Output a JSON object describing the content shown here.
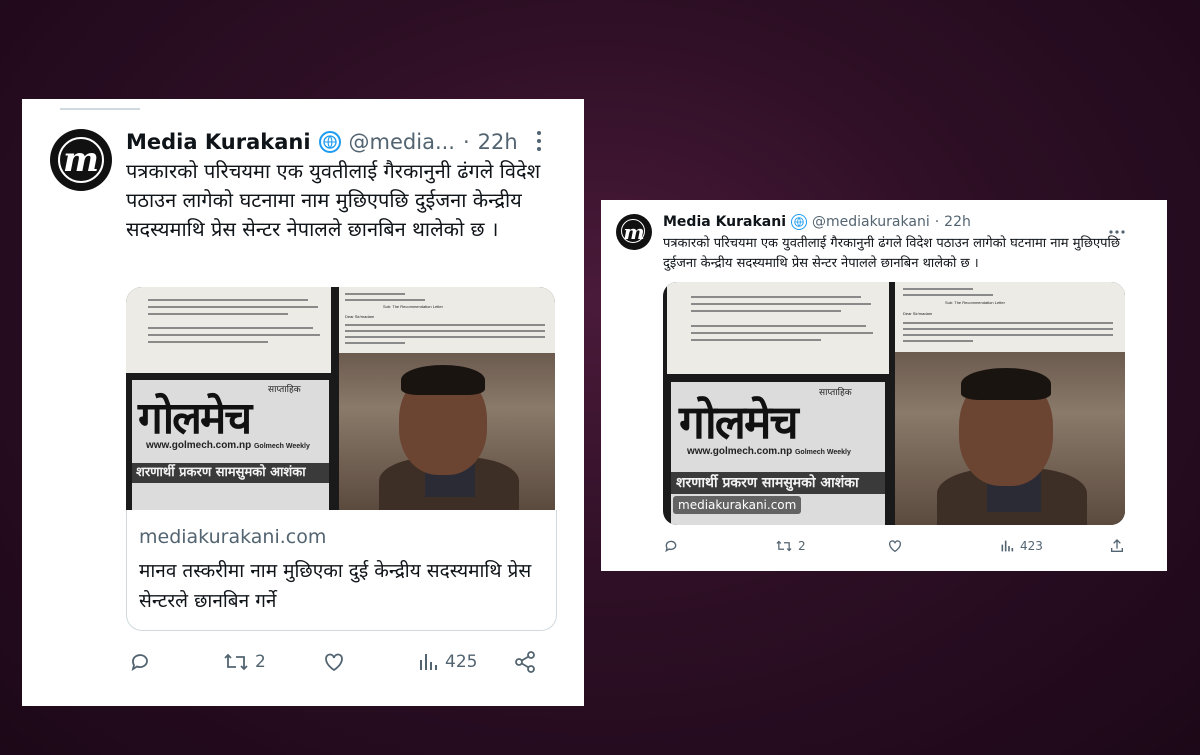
{
  "left_tweet": {
    "author_name": "Media Kurakani",
    "handle": "@media...",
    "time": "22h",
    "text": "पत्रकारको परिचयमा एक युवतीलाई गैरकानुनी ढंगले विदेश पठाउन लागेको घटनामा नाम मुछिएपछि दुईजना केन्द्रीय सदस्यमाथि प्रेस सेन्टर नेपालले छानबिन थालेको छ ।",
    "link_domain": "mediakurakani.com",
    "link_title": "मानव तस्करीमा नाम मुछिएका दुई केन्द्रीय सदस्यमाथि प्रेस सेन्टरले छानबिन गर्ने",
    "retweets": "2",
    "views": "425"
  },
  "right_tweet": {
    "author_name": "Media Kurakani",
    "handle": "@mediakurakani",
    "time": "22h",
    "text": "पत्रकारको परिचयमा एक युवतीलाई गैरकानुनी ढंगले विदेश पठाउन लागेको घटनामा नाम मुछिएपछि दुईजना केन्द्रीय सदस्यमाथि प्रेस सेन्टर नेपालले छानबिन थालेको छ ।",
    "watermark": "mediakurakani.com",
    "retweets": "2",
    "views": "423"
  },
  "media_image": {
    "newspaper_masthead": "गोलमेच",
    "newspaper_kicker": "साप्ताहिक",
    "newspaper_url": "www.golmech.com.np",
    "newspaper_tagline": "Golmech Weekly",
    "newspaper_headline": "शरणार्थी प्रकरण सामसुमको आशंका",
    "letter_subject": "Sub: The Recommendation Letter",
    "letter_salutation": "Dear Sir/madam"
  },
  "avatar_letter": "m",
  "icons": [
    "verified-icon",
    "more-icon",
    "reply-icon",
    "retweet-icon",
    "like-icon",
    "views-icon",
    "share-icon"
  ],
  "colors": {
    "verified": "#1d9bf0",
    "muted": "#536471",
    "text": "#0f1419"
  }
}
